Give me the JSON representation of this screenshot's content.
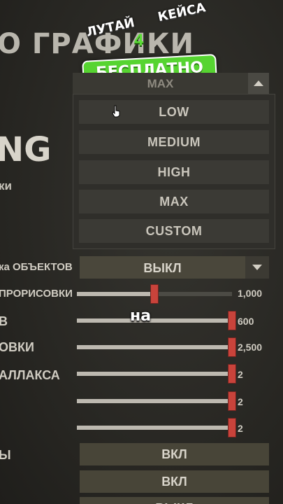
{
  "page": {
    "title": "О ГРАФИКИ",
    "section_heading": "NG",
    "section_subheading": "ки"
  },
  "promo": {
    "top_text": "ЛУТАЙ",
    "number": "4",
    "top_text_2": "КЕЙСА",
    "badge_text": "БЕСПЛАТНО"
  },
  "quality_dropdown": {
    "current_value": "MAX",
    "options": [
      "LOW",
      "MEDIUM",
      "HIGH",
      "MAX",
      "CUSTOM"
    ]
  },
  "settings": {
    "object_quality": {
      "label": "ка ОБЪЕКТОВ",
      "value": "ВЫКЛ"
    },
    "sliders": [
      {
        "label": "ПРОРИСОВКИ",
        "value_text": "1,000",
        "fraction": 0.5
      },
      {
        "label": "В",
        "value_text": "600",
        "fraction": 1.0
      },
      {
        "label": "ОВКИ",
        "value_text": "2,500",
        "fraction": 1.0
      },
      {
        "label": "АЛЛАКСА",
        "value_text": "2",
        "fraction": 1.0
      },
      {
        "label": "",
        "value_text": "2",
        "fraction": 1.0
      },
      {
        "label": "",
        "value_text": "2",
        "fraction": 1.0
      }
    ],
    "toggles": [
      {
        "label": "Ы",
        "value": "ВКЛ"
      },
      {
        "label": "",
        "value": "ВКЛ"
      },
      {
        "label": "",
        "value": "ВЫКЛ"
      }
    ]
  },
  "caption": "на",
  "colors": {
    "accent_green": "#56d431",
    "slider_thumb": "#c9433b"
  }
}
